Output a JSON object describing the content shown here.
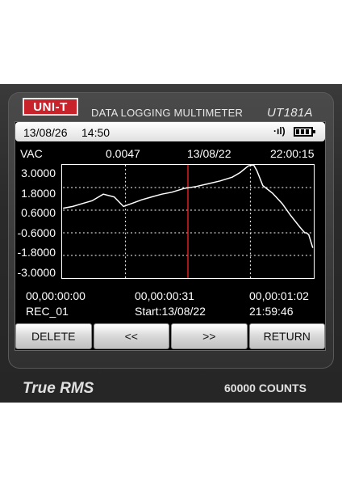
{
  "header": {
    "brand": "UNI-T",
    "title": "DATA LOGGING MULTIMETER",
    "model": "UT181A"
  },
  "status": {
    "date": "13/08/26",
    "time": "14:50",
    "signal_glyph": "·ıl)",
    "battery_icon": "battery-icon"
  },
  "info": {
    "mode": "VAC",
    "value": "0.0047",
    "date": "13/08/22",
    "time": "22:00:15"
  },
  "y_ticks": [
    "3.0000",
    "1.8000",
    "0.6000",
    "-0.6000",
    "-1.8000",
    "-3.0000"
  ],
  "x_labels": {
    "start": "00,00:00:00",
    "middle": "00,00:00:31",
    "end": "00,00:01:02"
  },
  "record": {
    "name": "REC_01",
    "start": "Start:13/08/22",
    "start_time": "21:59:46"
  },
  "buttons": {
    "delete": "DELETE",
    "prev": "<<",
    "next": ">>",
    "return": "RETURN"
  },
  "footer": {
    "left": "True RMS",
    "right": "60000  COUNTS"
  },
  "colors": {
    "trace": "#ffffff",
    "cursor": "#e02020",
    "brand_red": "#c8232b"
  },
  "chart_data": {
    "type": "line",
    "ylim": [
      -3.0,
      3.0
    ],
    "xlim": [
      0,
      62
    ],
    "cursor_x": 31,
    "x": [
      0,
      2.4,
      4.8,
      7.2,
      10,
      12.7,
      15,
      17,
      19.5,
      22,
      24.5,
      27,
      30,
      33,
      36,
      39,
      42,
      44,
      46,
      47.3,
      48.1,
      49.6,
      52,
      54.4,
      56.4,
      58.8,
      60,
      60.4,
      61,
      62
    ],
    "values": [
      0.7,
      0.8,
      0.95,
      1.1,
      1.45,
      1.3,
      0.8,
      0.95,
      1.15,
      1.3,
      1.45,
      1.55,
      1.75,
      1.85,
      2.0,
      2.15,
      2.35,
      2.6,
      2.95,
      3.0,
      2.7,
      1.9,
      1.5,
      0.95,
      0.35,
      -0.3,
      -0.6,
      -0.6,
      -0.7,
      -1.4
    ]
  }
}
